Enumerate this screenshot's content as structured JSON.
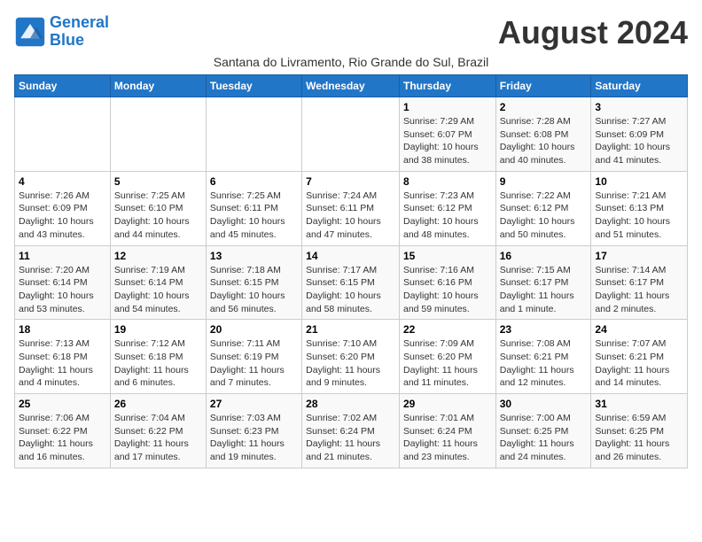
{
  "header": {
    "logo_general": "General",
    "logo_blue": "Blue",
    "month_title": "August 2024",
    "subtitle": "Santana do Livramento, Rio Grande do Sul, Brazil"
  },
  "days_of_week": [
    "Sunday",
    "Monday",
    "Tuesday",
    "Wednesday",
    "Thursday",
    "Friday",
    "Saturday"
  ],
  "weeks": [
    [
      {
        "day": "",
        "info": ""
      },
      {
        "day": "",
        "info": ""
      },
      {
        "day": "",
        "info": ""
      },
      {
        "day": "",
        "info": ""
      },
      {
        "day": "1",
        "info": "Sunrise: 7:29 AM\nSunset: 6:07 PM\nDaylight: 10 hours\nand 38 minutes."
      },
      {
        "day": "2",
        "info": "Sunrise: 7:28 AM\nSunset: 6:08 PM\nDaylight: 10 hours\nand 40 minutes."
      },
      {
        "day": "3",
        "info": "Sunrise: 7:27 AM\nSunset: 6:09 PM\nDaylight: 10 hours\nand 41 minutes."
      }
    ],
    [
      {
        "day": "4",
        "info": "Sunrise: 7:26 AM\nSunset: 6:09 PM\nDaylight: 10 hours\nand 43 minutes."
      },
      {
        "day": "5",
        "info": "Sunrise: 7:25 AM\nSunset: 6:10 PM\nDaylight: 10 hours\nand 44 minutes."
      },
      {
        "day": "6",
        "info": "Sunrise: 7:25 AM\nSunset: 6:11 PM\nDaylight: 10 hours\nand 45 minutes."
      },
      {
        "day": "7",
        "info": "Sunrise: 7:24 AM\nSunset: 6:11 PM\nDaylight: 10 hours\nand 47 minutes."
      },
      {
        "day": "8",
        "info": "Sunrise: 7:23 AM\nSunset: 6:12 PM\nDaylight: 10 hours\nand 48 minutes."
      },
      {
        "day": "9",
        "info": "Sunrise: 7:22 AM\nSunset: 6:12 PM\nDaylight: 10 hours\nand 50 minutes."
      },
      {
        "day": "10",
        "info": "Sunrise: 7:21 AM\nSunset: 6:13 PM\nDaylight: 10 hours\nand 51 minutes."
      }
    ],
    [
      {
        "day": "11",
        "info": "Sunrise: 7:20 AM\nSunset: 6:14 PM\nDaylight: 10 hours\nand 53 minutes."
      },
      {
        "day": "12",
        "info": "Sunrise: 7:19 AM\nSunset: 6:14 PM\nDaylight: 10 hours\nand 54 minutes."
      },
      {
        "day": "13",
        "info": "Sunrise: 7:18 AM\nSunset: 6:15 PM\nDaylight: 10 hours\nand 56 minutes."
      },
      {
        "day": "14",
        "info": "Sunrise: 7:17 AM\nSunset: 6:15 PM\nDaylight: 10 hours\nand 58 minutes."
      },
      {
        "day": "15",
        "info": "Sunrise: 7:16 AM\nSunset: 6:16 PM\nDaylight: 10 hours\nand 59 minutes."
      },
      {
        "day": "16",
        "info": "Sunrise: 7:15 AM\nSunset: 6:17 PM\nDaylight: 11 hours\nand 1 minute."
      },
      {
        "day": "17",
        "info": "Sunrise: 7:14 AM\nSunset: 6:17 PM\nDaylight: 11 hours\nand 2 minutes."
      }
    ],
    [
      {
        "day": "18",
        "info": "Sunrise: 7:13 AM\nSunset: 6:18 PM\nDaylight: 11 hours\nand 4 minutes."
      },
      {
        "day": "19",
        "info": "Sunrise: 7:12 AM\nSunset: 6:18 PM\nDaylight: 11 hours\nand 6 minutes."
      },
      {
        "day": "20",
        "info": "Sunrise: 7:11 AM\nSunset: 6:19 PM\nDaylight: 11 hours\nand 7 minutes."
      },
      {
        "day": "21",
        "info": "Sunrise: 7:10 AM\nSunset: 6:20 PM\nDaylight: 11 hours\nand 9 minutes."
      },
      {
        "day": "22",
        "info": "Sunrise: 7:09 AM\nSunset: 6:20 PM\nDaylight: 11 hours\nand 11 minutes."
      },
      {
        "day": "23",
        "info": "Sunrise: 7:08 AM\nSunset: 6:21 PM\nDaylight: 11 hours\nand 12 minutes."
      },
      {
        "day": "24",
        "info": "Sunrise: 7:07 AM\nSunset: 6:21 PM\nDaylight: 11 hours\nand 14 minutes."
      }
    ],
    [
      {
        "day": "25",
        "info": "Sunrise: 7:06 AM\nSunset: 6:22 PM\nDaylight: 11 hours\nand 16 minutes."
      },
      {
        "day": "26",
        "info": "Sunrise: 7:04 AM\nSunset: 6:22 PM\nDaylight: 11 hours\nand 17 minutes."
      },
      {
        "day": "27",
        "info": "Sunrise: 7:03 AM\nSunset: 6:23 PM\nDaylight: 11 hours\nand 19 minutes."
      },
      {
        "day": "28",
        "info": "Sunrise: 7:02 AM\nSunset: 6:24 PM\nDaylight: 11 hours\nand 21 minutes."
      },
      {
        "day": "29",
        "info": "Sunrise: 7:01 AM\nSunset: 6:24 PM\nDaylight: 11 hours\nand 23 minutes."
      },
      {
        "day": "30",
        "info": "Sunrise: 7:00 AM\nSunset: 6:25 PM\nDaylight: 11 hours\nand 24 minutes."
      },
      {
        "day": "31",
        "info": "Sunrise: 6:59 AM\nSunset: 6:25 PM\nDaylight: 11 hours\nand 26 minutes."
      }
    ]
  ]
}
